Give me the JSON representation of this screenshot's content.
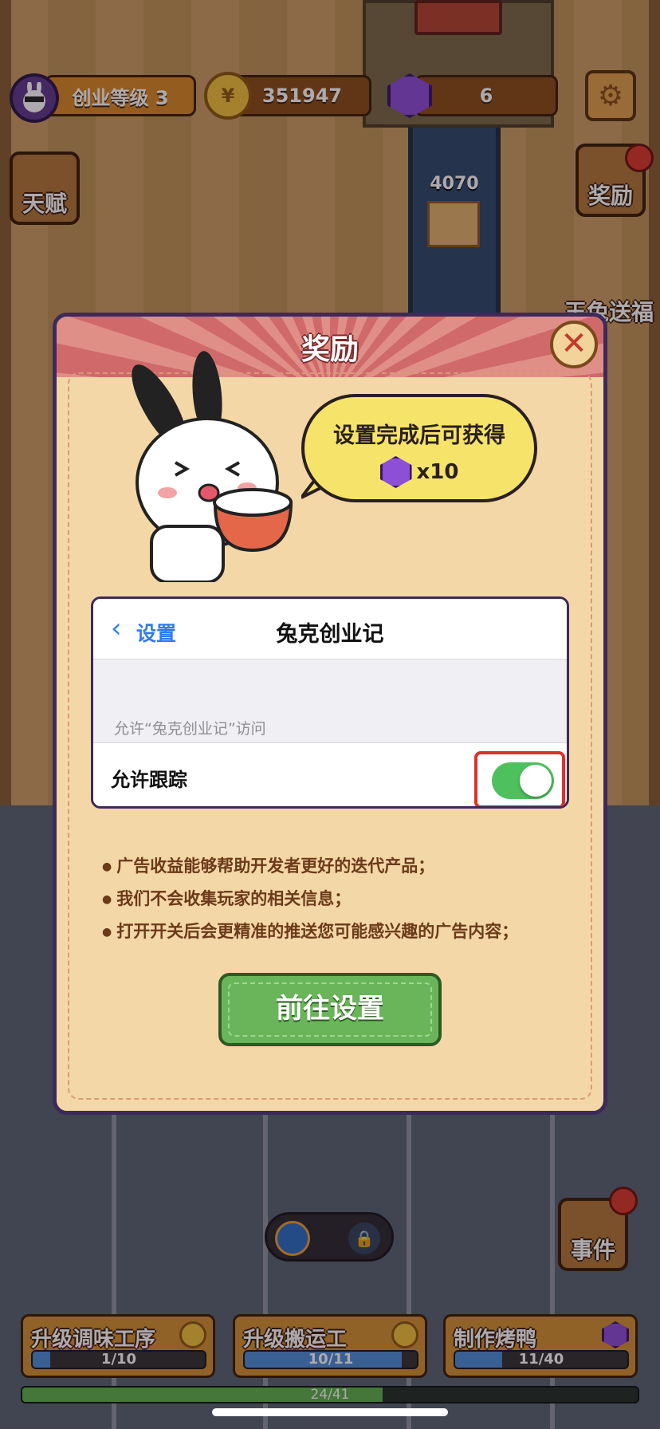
{
  "hud": {
    "level_label": "创业等级 3",
    "coins": "351947",
    "gems": "6",
    "settings_icon": "gear-icon"
  },
  "side": {
    "talent": "天赋",
    "reward": "奖励",
    "rabbit_blessing": "玉兔送福",
    "event": "事件"
  },
  "scene": {
    "box_count": "4070"
  },
  "dialog": {
    "title": "奖励",
    "bubble_text": "设置完成后可获得",
    "reward_count": "x10",
    "settings_panel": {
      "back_label": "设置",
      "title": "兔克创业记",
      "section_header": "允许“兔克创业记”访问",
      "row_label": "允许跟踪",
      "toggle_on": true
    },
    "notes": [
      "广告收益能够帮助开发者更好的迭代产品；",
      "我们不会收集玩家的相关信息；",
      "打开开关后会更精准的推送您可能感兴趣的广告内容；"
    ],
    "button_label": "前往设置"
  },
  "tasks": [
    {
      "title": "升级调味工序",
      "progress": "1/10",
      "fraction": 0.1,
      "icon": "coin-icon"
    },
    {
      "title": "升级搬运工",
      "progress": "10/11",
      "fraction": 0.91,
      "icon": "coin-icon"
    },
    {
      "title": "制作烤鸭",
      "progress": "11/40",
      "fraction": 0.275,
      "icon": "gem-icon"
    }
  ],
  "main_progress": {
    "text": "24/41",
    "fraction": 0.585
  },
  "colors": {
    "dialog_bg": "#f4d7a6",
    "header_red": "#d06a6a",
    "toggle_green": "#4ec15e",
    "highlight_red": "#e0302a",
    "button_green": "#6ab45a",
    "ios_blue": "#2f7bf5"
  }
}
